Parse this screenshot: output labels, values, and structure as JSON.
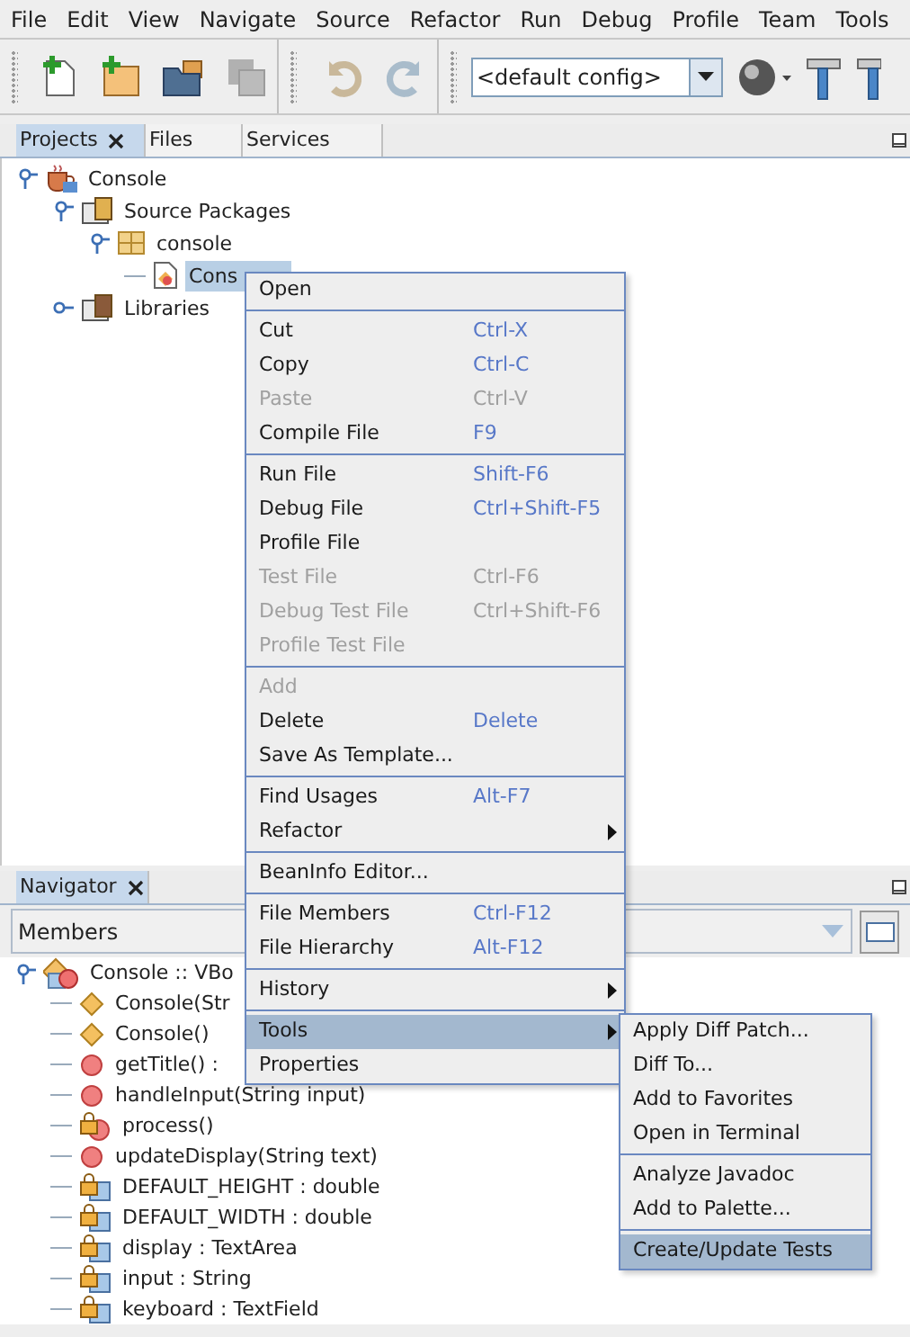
{
  "menubar": [
    {
      "label": "File"
    },
    {
      "label": "Edit"
    },
    {
      "label": "View"
    },
    {
      "label": "Navigate"
    },
    {
      "label": "Source"
    },
    {
      "label": "Refactor"
    },
    {
      "label": "Run"
    },
    {
      "label": "Debug"
    },
    {
      "label": "Profile"
    },
    {
      "label": "Team"
    },
    {
      "label": "Tools"
    }
  ],
  "toolbar": {
    "config_combo": {
      "value": "<default config>"
    }
  },
  "projects_panel": {
    "tabs": [
      {
        "label": "Projects",
        "selected": true
      },
      {
        "label": "Files",
        "selected": false
      },
      {
        "label": "Services",
        "selected": false
      }
    ],
    "tree": [
      {
        "label": "Console",
        "kind": "project",
        "expanded": true,
        "selected": false,
        "children": [
          {
            "label": "Source Packages",
            "kind": "source-root",
            "expanded": true,
            "selected": false,
            "children": [
              {
                "label": "console",
                "kind": "package",
                "expanded": true,
                "selected": false,
                "children": [
                  {
                    "label": "Cons",
                    "kind": "file",
                    "selected": true
                  }
                ]
              }
            ]
          },
          {
            "label": "Libraries",
            "kind": "library",
            "expanded": false,
            "selected": false
          }
        ]
      }
    ]
  },
  "navigator": {
    "tabs": [
      {
        "label": "Navigator",
        "selected": true
      }
    ],
    "filter_combo": {
      "value": "Members"
    },
    "tree": [
      {
        "label": "Console :: VBo",
        "kind": "class",
        "expanded": true,
        "children": [
          {
            "label": "Console(Str",
            "kind": "constructor"
          },
          {
            "label": "Console()",
            "kind": "constructor"
          },
          {
            "label": "getTitle() :",
            "kind": "method"
          },
          {
            "label": "handleInput(String input)",
            "kind": "method"
          },
          {
            "label": "process()",
            "kind": "private-method"
          },
          {
            "label": "updateDisplay(String text)",
            "kind": "method"
          },
          {
            "label": "DEFAULT_HEIGHT : double",
            "kind": "private-field"
          },
          {
            "label": "DEFAULT_WIDTH : double",
            "kind": "private-field"
          },
          {
            "label": "display : TextArea",
            "kind": "private-field"
          },
          {
            "label": "input : String",
            "kind": "private-field"
          },
          {
            "label": "keyboard : TextField",
            "kind": "private-field"
          }
        ]
      }
    ]
  },
  "context_menu": {
    "groups": [
      [
        {
          "label": "Open",
          "disabled": false,
          "selected": false
        }
      ],
      [
        {
          "label": "Cut",
          "shortcut": "Ctrl-X",
          "disabled": false,
          "selected": false
        },
        {
          "label": "Copy",
          "shortcut": "Ctrl-C",
          "disabled": false,
          "selected": false
        },
        {
          "label": "Paste",
          "shortcut": "Ctrl-V",
          "disabled": true,
          "selected": false
        },
        {
          "label": "Compile File",
          "shortcut": "F9",
          "disabled": false,
          "selected": false
        }
      ],
      [
        {
          "label": "Run File",
          "shortcut": "Shift-F6",
          "disabled": false,
          "selected": false
        },
        {
          "label": "Debug File",
          "shortcut": "Ctrl+Shift-F5",
          "disabled": false,
          "selected": false
        },
        {
          "label": "Profile File",
          "disabled": false,
          "selected": false
        },
        {
          "label": "Test File",
          "shortcut": "Ctrl-F6",
          "disabled": true,
          "selected": false
        },
        {
          "label": "Debug Test File",
          "shortcut": "Ctrl+Shift-F6",
          "disabled": true,
          "selected": false
        },
        {
          "label": "Profile Test File",
          "disabled": true,
          "selected": false
        }
      ],
      [
        {
          "label": "Add",
          "disabled": true,
          "selected": false
        },
        {
          "label": "Delete",
          "shortcut": "Delete",
          "disabled": false,
          "selected": false
        },
        {
          "label": "Save As Template...",
          "disabled": false,
          "selected": false
        }
      ],
      [
        {
          "label": "Find Usages",
          "shortcut": "Alt-F7",
          "disabled": false,
          "selected": false
        },
        {
          "label": "Refactor",
          "submenu": true,
          "disabled": false,
          "selected": false
        }
      ],
      [
        {
          "label": "BeanInfo Editor...",
          "disabled": false,
          "selected": false
        }
      ],
      [
        {
          "label": "File Members",
          "shortcut": "Ctrl-F12",
          "disabled": false,
          "selected": false
        },
        {
          "label": "File Hierarchy",
          "shortcut": "Alt-F12",
          "disabled": false,
          "selected": false
        }
      ],
      [
        {
          "label": "History",
          "submenu": true,
          "disabled": false,
          "selected": false
        }
      ],
      [
        {
          "label": "Tools",
          "submenu": true,
          "disabled": false,
          "selected": true
        },
        {
          "label": "Properties",
          "disabled": false,
          "selected": false
        }
      ]
    ]
  },
  "tools_submenu": {
    "groups": [
      [
        {
          "label": "Apply Diff Patch...",
          "selected": false
        },
        {
          "label": "Diff To...",
          "selected": false
        },
        {
          "label": "Add to Favorites",
          "selected": false
        },
        {
          "label": "Open in Terminal",
          "selected": false
        }
      ],
      [
        {
          "label": "Analyze Javadoc",
          "selected": false
        },
        {
          "label": "Add to Palette...",
          "selected": false
        }
      ],
      [
        {
          "label": "Create/Update Tests",
          "selected": true
        }
      ]
    ]
  }
}
